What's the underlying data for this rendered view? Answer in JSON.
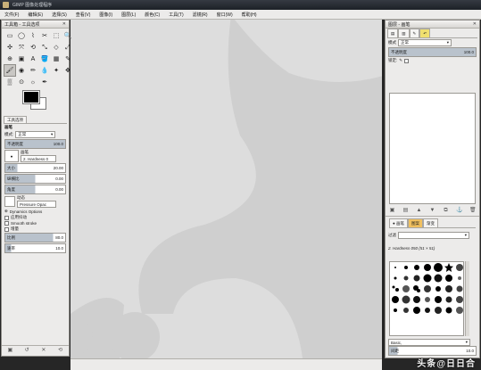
{
  "window": {
    "title": "GIMP 图像处理程序"
  },
  "menubar": {
    "items": [
      "文件(F)",
      "编辑(E)",
      "选择(S)",
      "查看(V)",
      "图像(I)",
      "图层(L)",
      "颜色(C)",
      "工具(T)",
      "滤镜(R)",
      "窗口(W)",
      "帮助(H)"
    ]
  },
  "toolbox": {
    "title": "工具箱 - 工具选项",
    "tools": [
      "▭",
      "◯",
      "⌇",
      "✂",
      "⬚",
      "🔍",
      "✣",
      "⤧",
      "⟲",
      "⤡",
      "◇",
      "⤢",
      "⊕",
      "▣",
      "A",
      "🪣",
      "▦",
      "✎",
      "🖌",
      "◉",
      "✏",
      "💧",
      "✦",
      "✥",
      "▒",
      "⊙",
      "☼",
      "✒"
    ],
    "options_tab": "工具选项",
    "section": "画笔",
    "mode_label": "模式:",
    "mode_value": "正常",
    "opacity_label": "不透明度",
    "opacity_value": "100.0",
    "opacity_fraction": 1.0,
    "brush_label": "画笔",
    "brush_value": "2. Hardness 0",
    "size_label": "大小",
    "size_value": "20.00",
    "aspect_label": "纵横比",
    "aspect_value": "0.00",
    "angle_label": "角度",
    "angle_value": "0.00",
    "dynamics_label": "动态",
    "dynamics_value": "Pressure Opac",
    "dynamics_options": "Dynamics Options",
    "jitter_label": "应用抖动",
    "smooth_label": "Smooth stroke",
    "incremental_label": "增量",
    "hardness_label": "比例",
    "hardness_value": "80.0",
    "rate_label": "速率",
    "rate_value": "10.0"
  },
  "layers": {
    "title": "图层 - 画笔",
    "mode_label": "模式",
    "mode_value": "正常",
    "opacity_label": "不透明度",
    "opacity_value": "100.0",
    "opacity_fraction": 1.0,
    "lock_label": "锁定:"
  },
  "brushes": {
    "tab_brushes": "画笔",
    "tab_patterns": "图案",
    "tab_gradients": "渐变",
    "filter_label": "过滤",
    "current": "2. Hardness 050 (51 × 51)",
    "preset": "Basic,",
    "spacing_label": "间距",
    "spacing_value": "10.0"
  },
  "watermark": "头条@日日合"
}
